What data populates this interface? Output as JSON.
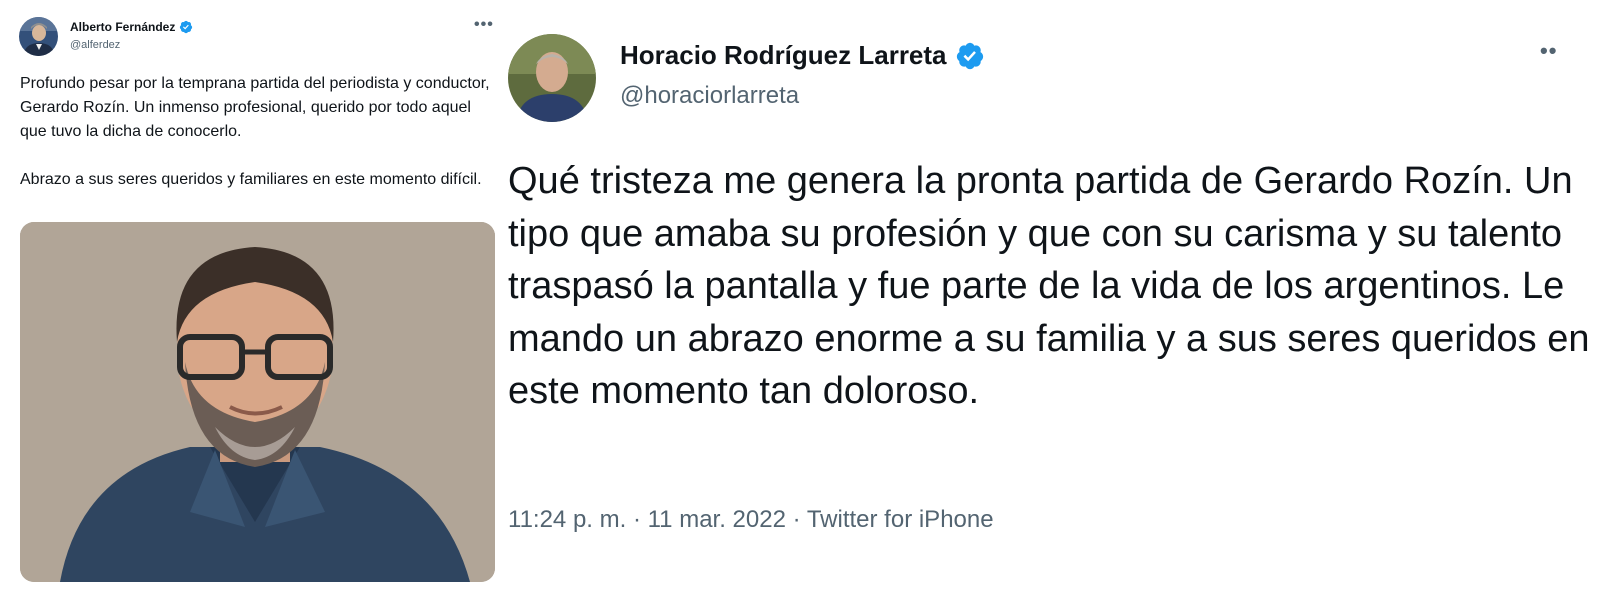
{
  "left_tweet": {
    "author_name": "Alberto Fernández",
    "author_handle": "@alferdez",
    "more_glyph": "•••",
    "paragraphs": [
      "Profundo pesar por la temprana partida del periodista y conductor, Gerardo Rozín. Un inmenso profesional, querido por todo aquel que tuvo la dicha de conocerlo.",
      "Abrazo a sus seres queridos y familiares en este momento difícil."
    ],
    "verified_color": "#1d9bf0"
  },
  "right_tweet": {
    "author_name": "Horacio Rodríguez Larreta",
    "author_handle": "@horaciorlarreta",
    "more_glyph": "••",
    "text": "Qué tristeza me genera la pronta partida de Gerardo Rozín. Un tipo que amaba su profesión y que con su carisma y su talento traspasó la pantalla y fue parte de la vida de los argentinos. Le mando un abrazo enorme a su familia y a sus seres queridos en este momento tan doloroso.",
    "meta": "11:24 p. m. · 11 mar. 2022 · Twitter for iPhone",
    "verified_color": "#1d9bf0"
  }
}
